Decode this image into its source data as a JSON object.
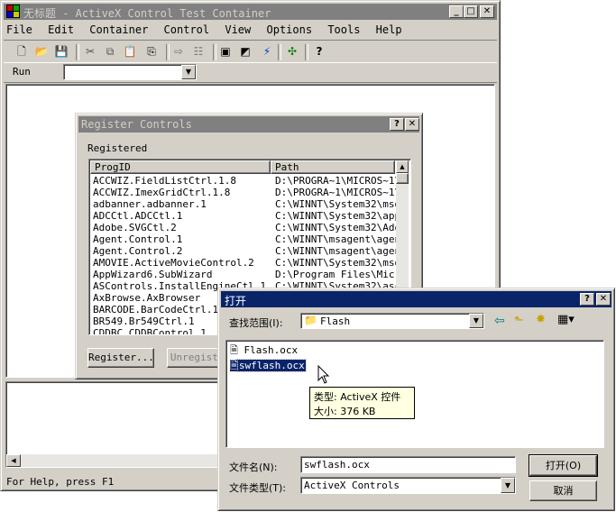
{
  "main_window": {
    "title": "无标题 - ActiveX Control Test Container",
    "menu": [
      "File",
      "Edit",
      "Container",
      "Control",
      "View",
      "Options",
      "Tools",
      "Help"
    ],
    "run_label": "Run",
    "status_text": "For Help, press F1"
  },
  "register_dialog": {
    "title": "Register Controls",
    "registered_label": "Registered",
    "columns": [
      "ProgID",
      "Path"
    ],
    "rows": [
      [
        "ACCWIZ.FieldListCtrl.1.8",
        "D:\\PROGRA~1\\MICROS~1\\0:"
      ],
      [
        "ACCWIZ.ImexGridCtrl.1.8",
        "D:\\PROGRA~1\\MICROS~1\\0:"
      ],
      [
        "adbanner.adbanner.1",
        "C:\\WINNT\\System32\\msdxm"
      ],
      [
        "ADCCtl.ADCCtl.1",
        "C:\\WINNT\\System32\\appw:"
      ],
      [
        "Adobe.SVGCtl.2",
        "C:\\WINNT\\System32\\Adobe"
      ],
      [
        "Agent.Control.1",
        "C:\\WINNT\\msagent\\agent"
      ],
      [
        "Agent.Control.2",
        "C:\\WINNT\\msagent\\agent"
      ],
      [
        "AMOVIE.ActiveMovieControl.2",
        "C:\\WINNT\\System32\\msdxm"
      ],
      [
        "AppWizard6.SubWizard",
        "D:\\Program Files\\Micros"
      ],
      [
        "ASControls.InstallEngineCtl.1",
        "C:\\WINNT\\System32\\asctr"
      ],
      [
        "AxBrowse.AxBrowser",
        ""
      ],
      [
        "BARCODE.BarCodeCtrl.1",
        ""
      ],
      [
        "BR549.Br549Ctrl.1",
        ""
      ],
      [
        "CDDBC.CDDBControl.1",
        ""
      ]
    ],
    "register_button": "Register...",
    "unregister_button": "Unregister"
  },
  "open_dialog": {
    "title": "打开",
    "lookin_label": "查找范围(I):",
    "lookin_value": "Flash",
    "files": [
      "Flash.ocx",
      "swflash.ocx"
    ],
    "selected_file": "swflash.ocx",
    "tooltip_type": "类型: ActiveX 控件",
    "tooltip_size": "大小: 376 KB",
    "filename_label": "文件名(N):",
    "filename_value": "swflash.ocx",
    "filetype_label": "文件类型(T):",
    "filetype_value": "ActiveX Controls",
    "open_button": "打开(O)",
    "cancel_button": "取消"
  },
  "colors": {
    "face": "#d4d0c8",
    "active_title": "#0a246a",
    "inactive_title": "#808080",
    "tooltip_bg": "#ffffe1"
  }
}
